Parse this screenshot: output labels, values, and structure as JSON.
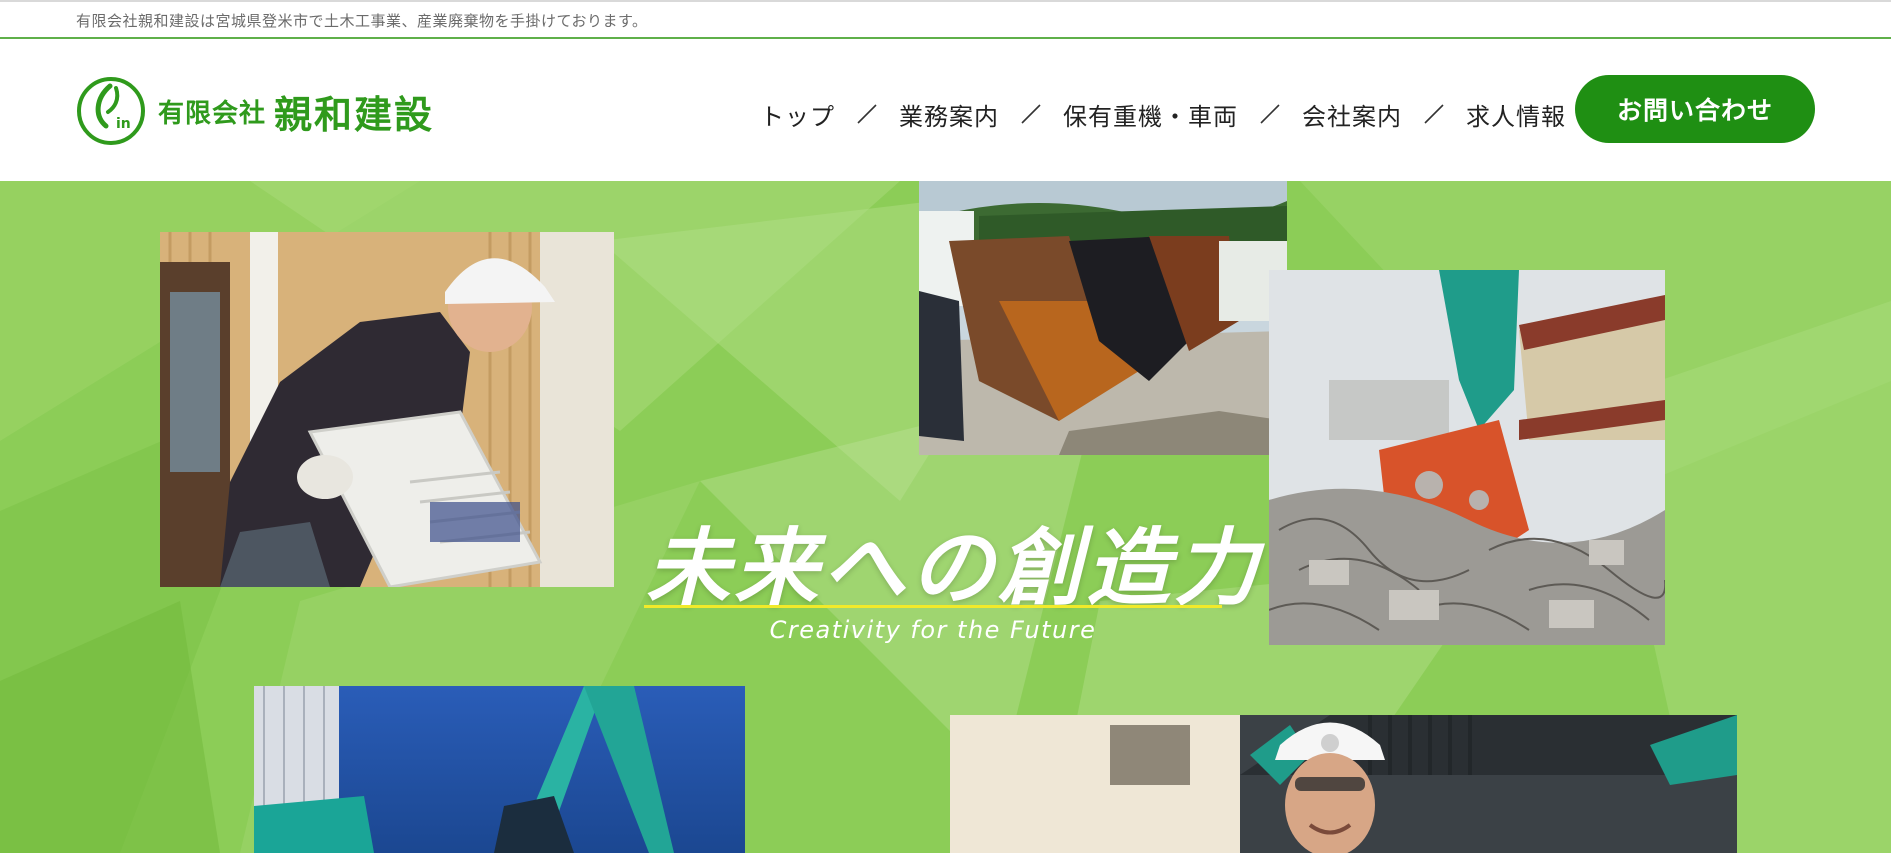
{
  "topbar": {
    "text": "有限会社親和建設は宮城県登米市で土木工事業、産業廃棄物を手掛けております。"
  },
  "header": {
    "logo": {
      "company": "有限会社",
      "name": "親和建設",
      "mark_text": "in"
    },
    "nav": [
      {
        "label": "トップ"
      },
      {
        "label": "業務案内"
      },
      {
        "label": "保有重機・車両"
      },
      {
        "label": "会社案内"
      },
      {
        "label": "求人情報"
      }
    ],
    "contact_label": "お問い合わせ"
  },
  "hero": {
    "title": "未来への創造力",
    "subtitle": "Creativity for the Future",
    "photos": [
      {
        "name": "worker-carrying-air-conditioner"
      },
      {
        "name": "excavator-buckets"
      },
      {
        "name": "demolition-crusher-attachment"
      },
      {
        "name": "long-reach-excavator-arm"
      },
      {
        "name": "smiling-foreman-with-helmet"
      }
    ]
  },
  "colors": {
    "brand_green": "#2f9a1c",
    "button_green": "#1f8f13",
    "hero_background": "#8ccd57",
    "accent_line": "#f1ea2a"
  }
}
